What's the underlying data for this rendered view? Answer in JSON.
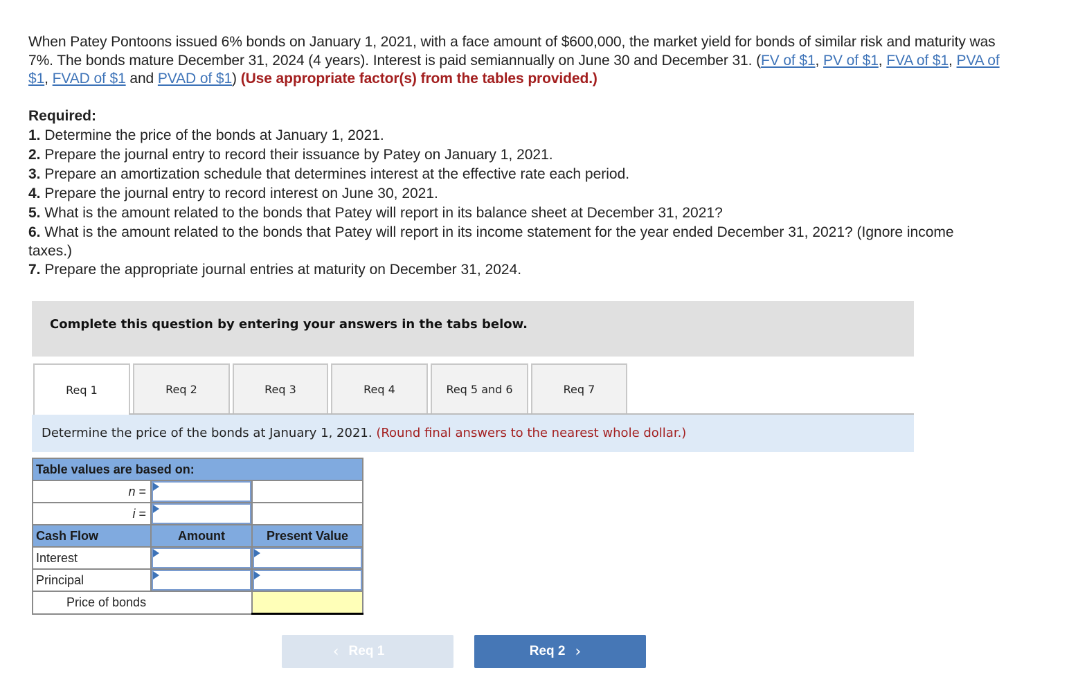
{
  "intro": {
    "text_1": "When Patey Pontoons issued 6% bonds on January 1, 2021, with a face amount of $600,000, the market yield for bonds of similar risk and maturity was 7%. The bonds mature December 31, 2024 (4 years). Interest is paid semiannually on June 30 and December 31. (",
    "links": [
      "FV of $1",
      "PV of $1",
      "FVA of $1",
      "PVA of $1",
      "FVAD of $1",
      "PVAD of $1"
    ],
    "sep": ", ",
    "and": " and ",
    "close_paren": ")",
    "instruction": "(Use appropriate factor(s) from the tables provided.)"
  },
  "required": {
    "heading": "Required:",
    "items": [
      {
        "num": "1.",
        "text": "Determine the price of the bonds at January 1, 2021."
      },
      {
        "num": "2.",
        "text": "Prepare the journal entry to record their issuance by Patey on January 1, 2021."
      },
      {
        "num": "3.",
        "text": "Prepare an amortization schedule that determines interest at the effective rate each period."
      },
      {
        "num": "4.",
        "text": "Prepare the journal entry to record interest on June 30, 2021."
      },
      {
        "num": "5.",
        "text": "What is the amount related to the bonds that Patey will report in its balance sheet at December 31, 2021?"
      },
      {
        "num": "6.",
        "text": "What is the amount related to the bonds that Patey will report in its income statement for the year ended December 31, 2021? (Ignore income taxes.)"
      },
      {
        "num": "7.",
        "text": "Prepare the appropriate journal entries at maturity on December 31, 2024."
      }
    ]
  },
  "banner": "Complete this question by entering your answers in the tabs below.",
  "tabs": [
    {
      "label": "Req 1",
      "active": true
    },
    {
      "label": "Req 2"
    },
    {
      "label": "Req 3"
    },
    {
      "label": "Req 4"
    },
    {
      "label": "Req 5 and 6"
    },
    {
      "label": "Req 7"
    }
  ],
  "instruction": {
    "text": "Determine the price of the bonds at January 1, 2021.",
    "note": "(Round final answers to the nearest whole dollar.)"
  },
  "table": {
    "header": "Table values are based on:",
    "n_label": "n",
    "i_label": "i",
    "eq": " =",
    "n_value": "",
    "i_value": "",
    "col_cash_flow": "Cash Flow",
    "col_amount": "Amount",
    "col_pv": "Present Value",
    "rows": [
      {
        "label": "Interest",
        "amount": "",
        "pv": ""
      },
      {
        "label": "Principal",
        "amount": "",
        "pv": ""
      }
    ],
    "total_label": "Price of bonds",
    "total_value": ""
  },
  "nav": {
    "prev_label": "Req 1",
    "next_label": "Req 2",
    "prev_icon": "‹",
    "next_icon": "›"
  }
}
